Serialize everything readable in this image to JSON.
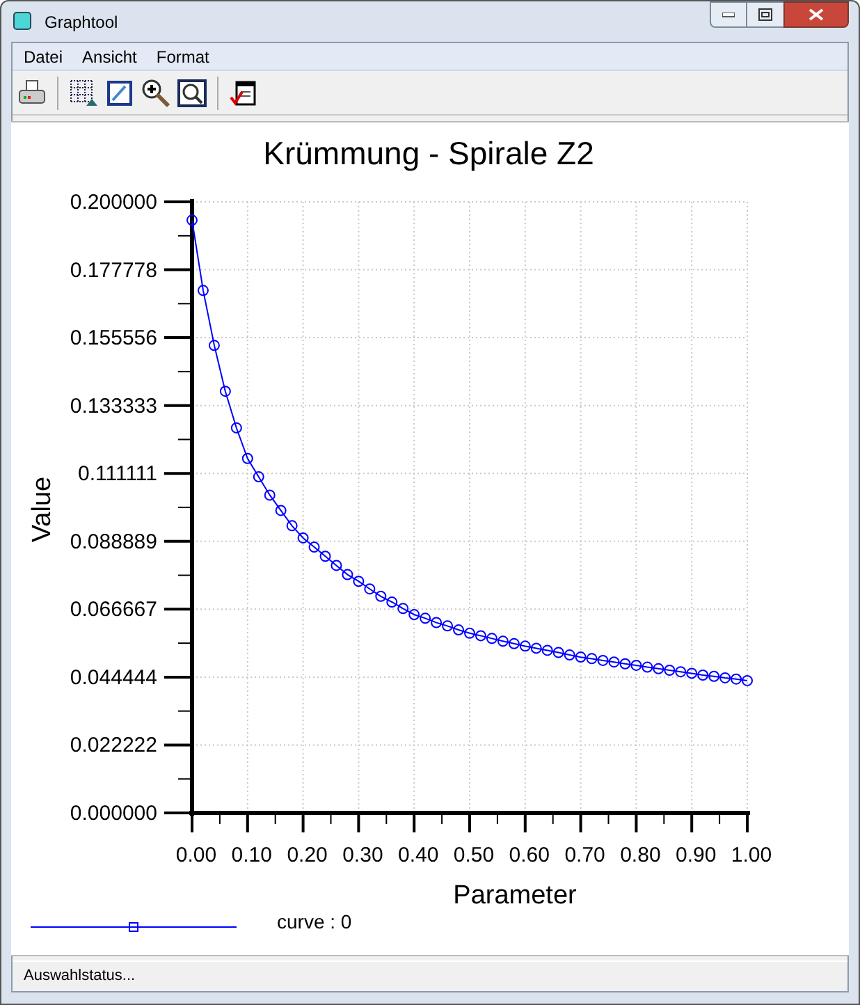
{
  "window": {
    "title": "Graphtool"
  },
  "menu": [
    {
      "label": "Datei"
    },
    {
      "label": "Ansicht"
    },
    {
      "label": "Format"
    }
  ],
  "chart": {
    "chart_data": {
      "type": "line",
      "title": "Krümmung - Spirale Z2",
      "xlabel": "Parameter",
      "ylabel": "Value",
      "x": [
        0,
        0.02,
        0.04,
        0.06,
        0.08,
        0.1,
        0.12,
        0.14,
        0.16,
        0.18,
        0.2,
        0.22,
        0.24,
        0.26,
        0.28,
        0.3,
        0.32,
        0.34,
        0.36,
        0.38,
        0.4,
        0.42,
        0.44,
        0.46,
        0.48,
        0.5,
        0.52,
        0.54,
        0.56,
        0.58,
        0.6,
        0.62,
        0.64,
        0.66,
        0.68,
        0.7,
        0.72,
        0.74,
        0.76,
        0.78,
        0.8,
        0.82,
        0.84,
        0.86,
        0.88,
        0.9,
        0.92,
        0.94,
        0.96,
        0.98,
        1
      ],
      "grid": true,
      "series": [
        {
          "name": "curve : 0",
          "color": "#0000ff",
          "marker": "circle",
          "values": [
            0.194,
            0.171,
            0.153,
            0.138,
            0.126,
            0.116,
            0.11,
            0.104,
            0.099,
            0.094,
            0.09,
            0.087,
            0.084,
            0.081,
            0.078,
            0.0758,
            0.0733,
            0.0709,
            0.069,
            0.0669,
            0.0649,
            0.0637,
            0.0623,
            0.0612,
            0.0599,
            0.0588,
            0.058,
            0.0571,
            0.0562,
            0.0554,
            0.0546,
            0.0539,
            0.0532,
            0.0525,
            0.0517,
            0.051,
            0.0505,
            0.0499,
            0.0494,
            0.0488,
            0.0483,
            0.0477,
            0.0472,
            0.0467,
            0.0462,
            0.0457,
            0.0451,
            0.0447,
            0.0442,
            0.0438,
            0.0433
          ]
        }
      ],
      "xlim": [
        0,
        1
      ],
      "ylim": [
        0,
        0.2
      ],
      "xticks": [
        {
          "value": 0,
          "label": "0.00"
        },
        {
          "value": 0.1,
          "label": "0.10"
        },
        {
          "value": 0.2,
          "label": "0.20"
        },
        {
          "value": 0.3,
          "label": "0.30"
        },
        {
          "value": 0.4,
          "label": "0.40"
        },
        {
          "value": 0.5,
          "label": "0.50"
        },
        {
          "value": 0.6,
          "label": "0.60"
        },
        {
          "value": 0.7,
          "label": "0.70"
        },
        {
          "value": 0.8,
          "label": "0.80"
        },
        {
          "value": 0.9,
          "label": "0.90"
        },
        {
          "value": 1,
          "label": "1.00"
        }
      ],
      "yticks": [
        {
          "value": 0,
          "label": "0.000000"
        },
        {
          "value": 0.022222,
          "label": "0.022222"
        },
        {
          "value": 0.044444,
          "label": "0.044444"
        },
        {
          "value": 0.066667,
          "label": "0.066667"
        },
        {
          "value": 0.088889,
          "label": "0.088889"
        },
        {
          "value": 0.111111,
          "label": "0.111111"
        },
        {
          "value": 0.133333,
          "label": "0.133333"
        },
        {
          "value": 0.155556,
          "label": "0.155556"
        },
        {
          "value": 0.177778,
          "label": "0.177778"
        },
        {
          "value": 0.2,
          "label": "0.200000"
        }
      ]
    }
  },
  "status_bar": {
    "text": "Auswahlstatus..."
  }
}
